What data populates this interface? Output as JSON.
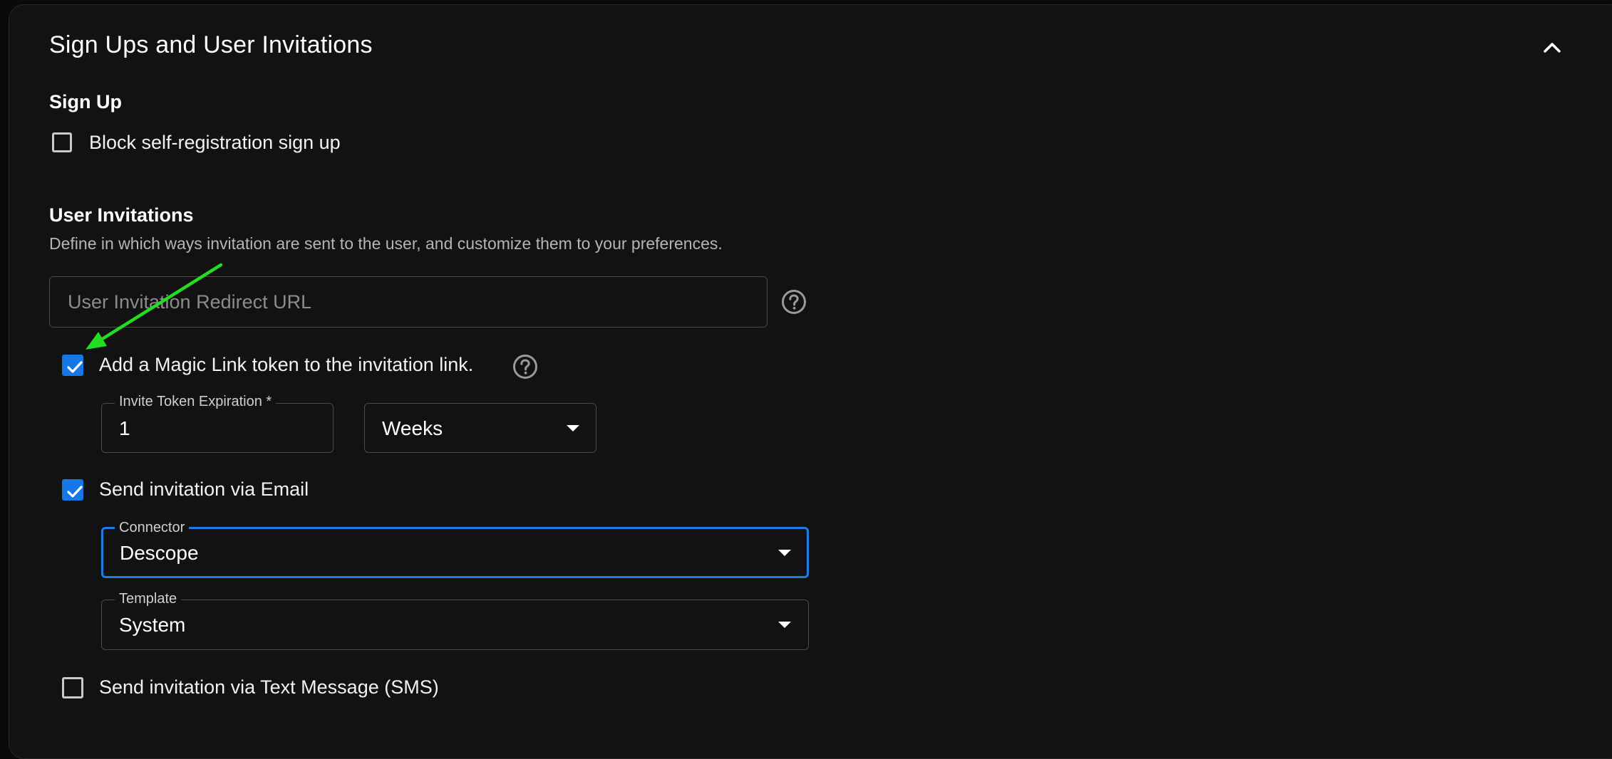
{
  "section": {
    "title": "Sign Ups and User Invitations"
  },
  "signup": {
    "heading": "Sign Up",
    "block_label": "Block self-registration sign up",
    "block_checked": false
  },
  "invitations": {
    "heading": "User Invitations",
    "description": "Define in which ways invitation are sent to the user, and customize them to your preferences.",
    "redirect_url": {
      "placeholder": "User Invitation Redirect URL",
      "value": ""
    },
    "magic_link": {
      "label": "Add a Magic Link token to the invitation link.",
      "checked": true
    },
    "expiration": {
      "label": "Invite Token Expiration *",
      "value": "1",
      "unit": "Weeks"
    },
    "email": {
      "label": "Send invitation via Email",
      "checked": true,
      "connector_label": "Connector",
      "connector_value": "Descope",
      "template_label": "Template",
      "template_value": "System"
    },
    "sms": {
      "label": "Send invitation via Text Message (SMS)",
      "checked": false
    }
  },
  "icons": {
    "collapse": "chevron-up-icon",
    "help": "question-circle-icon",
    "check": "checkmark-icon",
    "dropdown": "caret-down-icon",
    "annotation": "arrow-icon"
  },
  "colors": {
    "background": "#121212",
    "accent": "#1677e6",
    "annotation": "#22dd22"
  }
}
